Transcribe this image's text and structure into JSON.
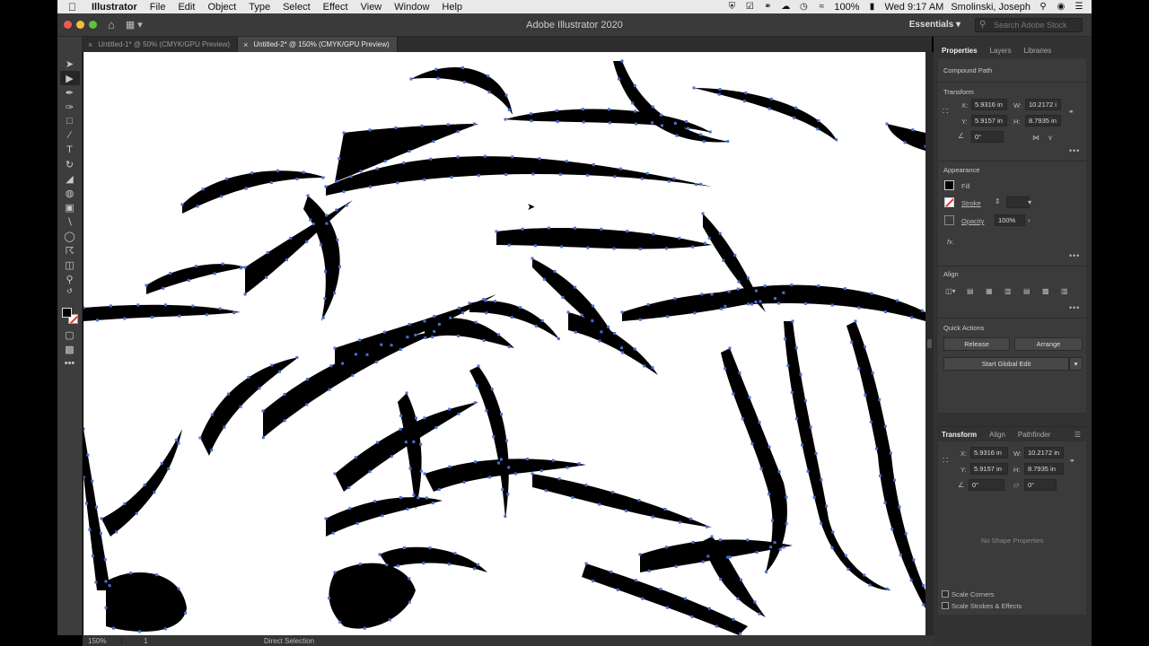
{
  "menubar": {
    "app_name": "Illustrator",
    "items": [
      "File",
      "Edit",
      "Object",
      "Type",
      "Select",
      "Effect",
      "View",
      "Window",
      "Help"
    ],
    "battery": "100%",
    "clock": "Wed 9:17 AM",
    "user": "Smolinski, Joseph"
  },
  "appbar": {
    "title": "Adobe Illustrator 2020",
    "workspace": "Essentials",
    "search_placeholder": "Search Adobe Stock"
  },
  "tabs": [
    {
      "label": "Untitled-1* @ 50% (CMYK/GPU Preview)",
      "active": false
    },
    {
      "label": "Untitled-2* @ 150% (CMYK/GPU Preview)",
      "active": true
    }
  ],
  "toolbar": {
    "tools": [
      "selection-tool",
      "direct-selection-tool",
      "curvature-tool",
      "pen-tool",
      "rectangle-tool",
      "paintbrush-tool",
      "type-tool",
      "rotate-tool",
      "eraser-tool",
      "shape-builder-tool",
      "gradient-tool",
      "eyedropper-tool",
      "blend-tool",
      "symbol-sprayer-tool",
      "artboard-tool",
      "zoom-tool"
    ],
    "selected": "direct-selection-tool",
    "more": "•••"
  },
  "properties": {
    "tabs": [
      "Properties",
      "Layers",
      "Libraries"
    ],
    "selection_type": "Compound Path",
    "transform": {
      "title": "Transform",
      "x_label": "X:",
      "x": "5.9316 in",
      "y_label": "Y:",
      "y": "5.9157 in",
      "w_label": "W:",
      "w": "10.2172 i",
      "h_label": "H:",
      "h": "8.7935 in",
      "angle": "0°"
    },
    "appearance": {
      "title": "Appearance",
      "fill": "Fill",
      "stroke": "Stroke",
      "opacity_label": "Opacity",
      "opacity": "100%",
      "fx": "fx."
    },
    "align": {
      "title": "Align"
    },
    "quick_actions": {
      "title": "Quick Actions",
      "release": "Release",
      "arrange": "Arrange",
      "global_edit": "Start Global Edit"
    }
  },
  "transform_panel": {
    "tabs": [
      "Transform",
      "Align",
      "Pathfinder"
    ],
    "x_label": "X:",
    "x": "5.9316 in",
    "y_label": "Y:",
    "y": "5.9157 in",
    "w_label": "W:",
    "w": "10.2172 in",
    "h_label": "H:",
    "h": "8.7935 in",
    "angle": "0°",
    "shear": "0°",
    "no_shape": "No Shape Properties",
    "scale_corners": "Scale Corners",
    "scale_strokes": "Scale Strokes & Effects"
  },
  "statusbar": {
    "zoom": "150%",
    "artboard": "1",
    "tool": "Direct Selection"
  },
  "colors": {
    "anchor": "#4a6fd6",
    "ink": "#000000"
  }
}
